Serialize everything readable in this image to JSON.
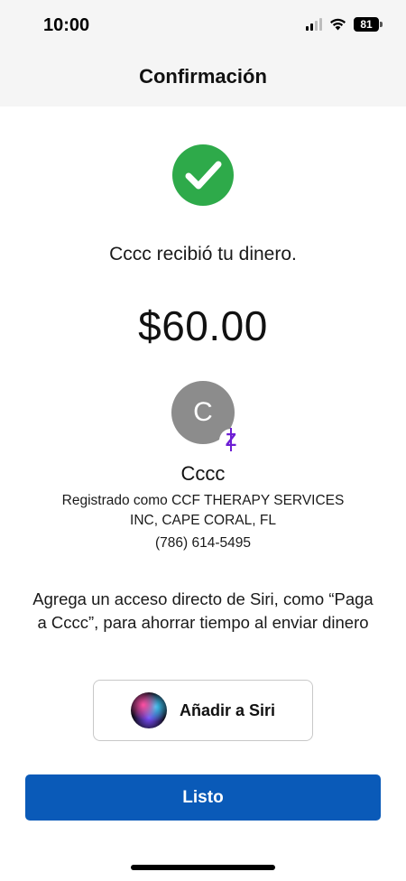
{
  "status_bar": {
    "time": "10:00",
    "battery": "81"
  },
  "header": {
    "title": "Confirmación"
  },
  "confirmation": {
    "message": "Cccc recibió tu dinero.",
    "amount": "$60.00"
  },
  "recipient": {
    "initial": "C",
    "name": "Cccc",
    "registered_as": "Registrado como CCF THERAPY SERVICES INC, CAPE CORAL, FL",
    "phone": "(786) 614-5495"
  },
  "siri": {
    "prompt": "Agrega un acceso directo de Siri, como “Paga a Cccc”, para ahorrar tiempo al enviar dinero",
    "button_label": "Añadir a Siri"
  },
  "actions": {
    "done_label": "Listo"
  },
  "colors": {
    "success_green": "#2eaa4a",
    "primary_blue": "#0a5ab8",
    "zelle_purple": "#6d1ed4",
    "avatar_gray": "#8c8c8c",
    "header_bg": "#f5f5f5"
  },
  "icons": {
    "success": "check-circle-icon",
    "siri": "siri-icon",
    "payment_network": "zelle-icon",
    "signal": "cellular-signal-icon",
    "wifi": "wifi-icon",
    "battery": "battery-icon"
  }
}
